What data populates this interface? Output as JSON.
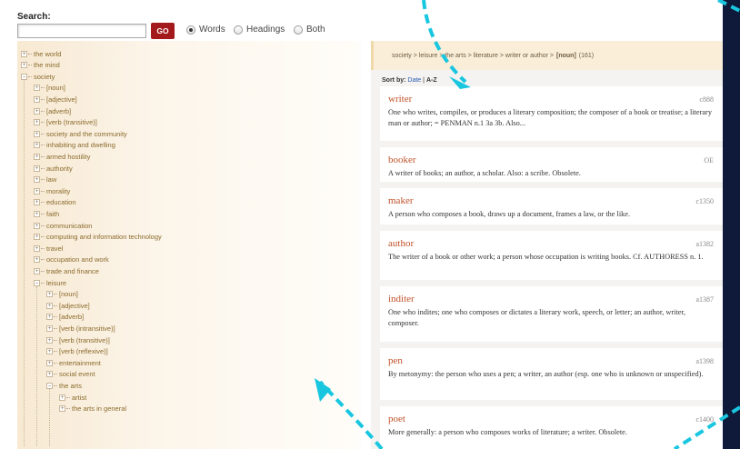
{
  "search": {
    "label": "Search:",
    "value": "",
    "placeholder": "",
    "go_label": "GO",
    "options": [
      {
        "label": "Words",
        "selected": true
      },
      {
        "label": "Headings",
        "selected": false
      },
      {
        "label": "Both",
        "selected": false
      }
    ]
  },
  "tree": {
    "root_items": [
      "the world",
      "the mind",
      "society"
    ],
    "society_children": [
      "[noun]",
      "[adjective]",
      "[adverb]",
      "[verb (transitive)]",
      "society and the community",
      "inhabiting and dwelling",
      "armed hostility",
      "authority",
      "law",
      "morality",
      "education",
      "faith",
      "communication",
      "computing and information technology",
      "travel",
      "occupation and work",
      "trade and finance",
      "leisure"
    ],
    "leisure_children": [
      "[noun]",
      "[adjective]",
      "[adverb]",
      "[verb (intransitive)]",
      "[verb (transitive)]",
      "[verb (reflexive)]",
      "entertainment",
      "social event",
      "the arts"
    ],
    "arts_children": [
      "artist",
      "the arts in general"
    ]
  },
  "breadcrumb": {
    "path": "society > leisure > the arts > literature > writer or author >",
    "heading": "[noun]",
    "count": "(161)"
  },
  "sort": {
    "label": "Sort by:",
    "date_label": "Date",
    "separator": "|",
    "az_label": "A-Z"
  },
  "entries": [
    {
      "word": "writer",
      "date": "c888",
      "definition": "One who writes, compiles, or produces a literary composition; the composer of a book or treatise; a literary man or author; = PENMAN n.1 3a 3b. Also..."
    },
    {
      "word": "booker",
      "date": "OE",
      "definition": "A writer of books; an author, a scholar. Also: a scribe. Obsolete."
    },
    {
      "word": "maker",
      "date": "c1350",
      "definition": "A person who composes a book, draws up a document, frames a law, or the like."
    },
    {
      "word": "author",
      "date": "a1382",
      "definition": "The writer of a book or other work; a person whose occupation is writing books. Cf. AUTHORESS n. 1."
    },
    {
      "word": "inditer",
      "date": "a1387",
      "definition": "One who indites; one who composes or dictates a literary work, speech, or letter; an author, writer, composer."
    },
    {
      "word": "pen",
      "date": "a1398",
      "definition": "By metonymy: the person who uses a pen; a writer, an author (esp. one who is unknown or unspecified)."
    },
    {
      "word": "poet",
      "date": "c1400",
      "definition": "More generally: a person who composes works of literature; a writer. Obsolete."
    }
  ],
  "colors": {
    "accent_red": "#a3191c",
    "headword": "#c0522a",
    "tree_text": "#8a6a2c",
    "link_blue": "#2a5bb0",
    "arrow_cyan": "#19c6e0",
    "frame_navy": "#0f1a3a"
  }
}
